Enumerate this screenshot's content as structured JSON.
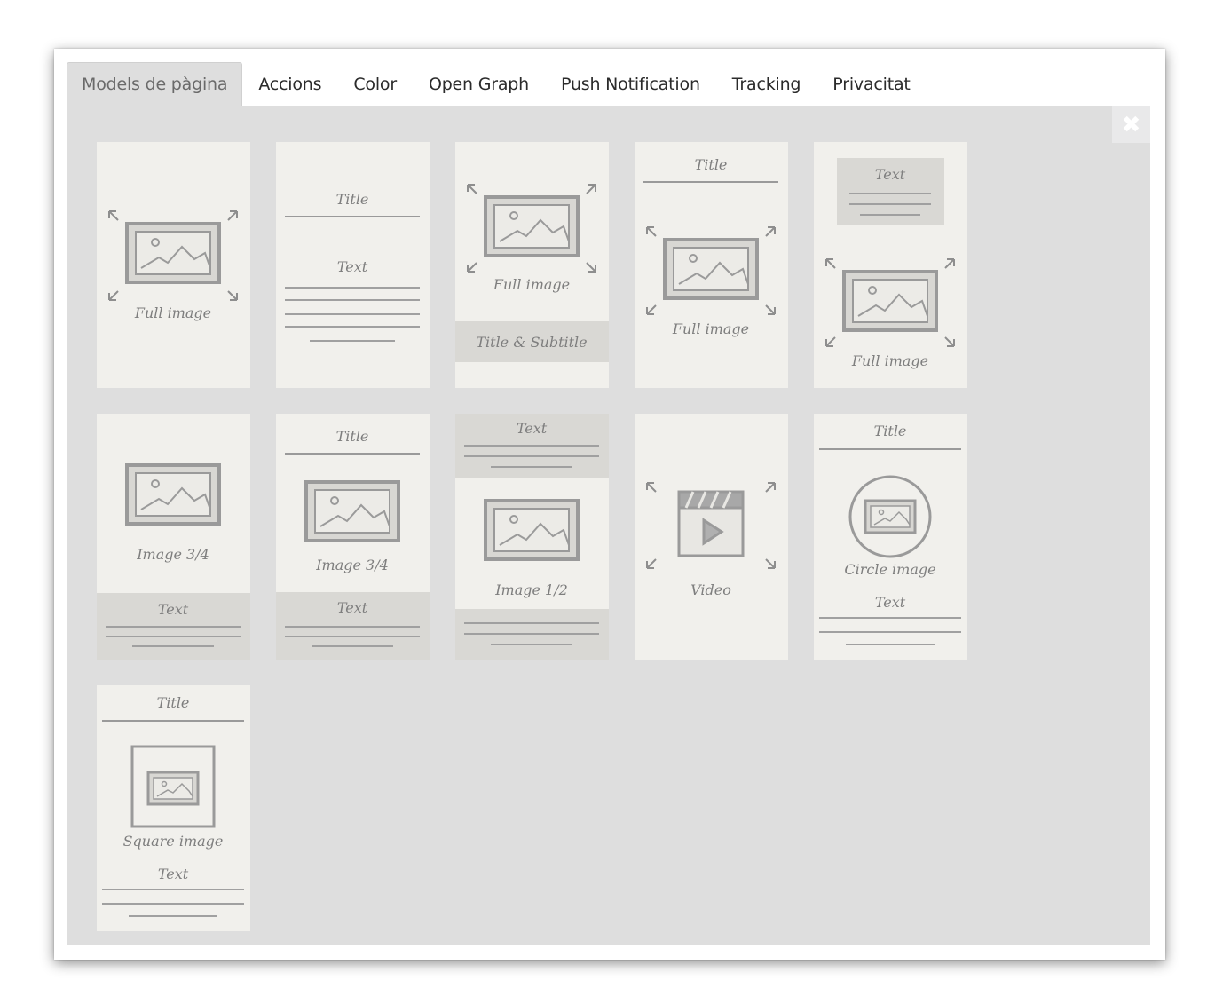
{
  "tabs": [
    {
      "label": "Models de pàgina",
      "active": true
    },
    {
      "label": "Accions",
      "active": false
    },
    {
      "label": "Color",
      "active": false
    },
    {
      "label": "Open Graph",
      "active": false
    },
    {
      "label": "Push Notification",
      "active": false
    },
    {
      "label": "Tracking",
      "active": false
    },
    {
      "label": "Privacitat",
      "active": false
    }
  ],
  "close_icon": "close-icon",
  "templates": [
    {
      "id": "full-image",
      "labels": [
        "Full image"
      ]
    },
    {
      "id": "title-text",
      "labels": [
        "Title",
        "Text"
      ]
    },
    {
      "id": "full-image-title-subtitle",
      "labels": [
        "Full image",
        "Title & Subtitle"
      ]
    },
    {
      "id": "title-full-image",
      "labels": [
        "Title",
        "Full image"
      ]
    },
    {
      "id": "text-full-image",
      "labels": [
        "Text",
        "Full image"
      ]
    },
    {
      "id": "image-3-4-text",
      "labels": [
        "Image 3/4",
        "Text"
      ]
    },
    {
      "id": "title-image-3-4-text",
      "labels": [
        "Title",
        "Image 3/4",
        "Text"
      ]
    },
    {
      "id": "text-image-1-2",
      "labels": [
        "Text",
        "Image 1/2"
      ]
    },
    {
      "id": "video",
      "labels": [
        "Video"
      ]
    },
    {
      "id": "title-circle-image-text",
      "labels": [
        "Title",
        "Circle image",
        "Text"
      ]
    },
    {
      "id": "title-square-image-text",
      "labels": [
        "Title",
        "Square image",
        "Text"
      ]
    }
  ]
}
